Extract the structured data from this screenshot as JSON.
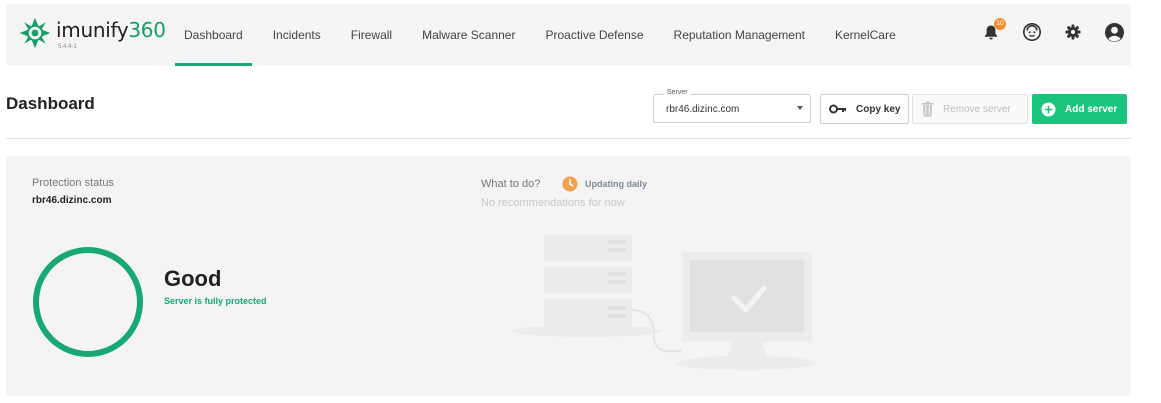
{
  "app": {
    "name": "imunify360",
    "name_prefix": "imunify",
    "name_suffix": "360",
    "version": "5.4.4-1"
  },
  "nav": {
    "tabs": [
      {
        "label": "Dashboard",
        "active": true
      },
      {
        "label": "Incidents",
        "active": false
      },
      {
        "label": "Firewall",
        "active": false
      },
      {
        "label": "Malware Scanner",
        "active": false
      },
      {
        "label": "Proactive Defense",
        "active": false
      },
      {
        "label": "Reputation Management",
        "active": false
      },
      {
        "label": "KernelCare",
        "active": false
      }
    ]
  },
  "top_icons": {
    "notifications": {
      "icon": "bell-icon",
      "badge": "10"
    },
    "support": {
      "icon": "support-agent-icon"
    },
    "settings": {
      "icon": "gear-icon"
    },
    "account": {
      "icon": "user-avatar-icon"
    }
  },
  "header": {
    "title": "Dashboard",
    "server_select": {
      "label": "Server",
      "value": "rbr46.dizinc.com"
    },
    "copy_key_label": "Copy key",
    "remove_server_label": "Remove server",
    "add_server_label": "Add server"
  },
  "protection": {
    "label": "Protection status",
    "host": "rbr46.dizinc.com",
    "status_title": "Good",
    "status_subtitle": "Server is fully protected"
  },
  "todo": {
    "label": "What to do?",
    "updating_label": "Updating daily",
    "empty_message": "No recommendations for now"
  },
  "colors": {
    "brand_green": "#1ba672",
    "add_button": "#1bc47d",
    "status_green": "#17a873",
    "badge_orange": "#f28c2e",
    "panel_bg": "#f4f4f4",
    "nav_bg": "#f5f5f5"
  }
}
